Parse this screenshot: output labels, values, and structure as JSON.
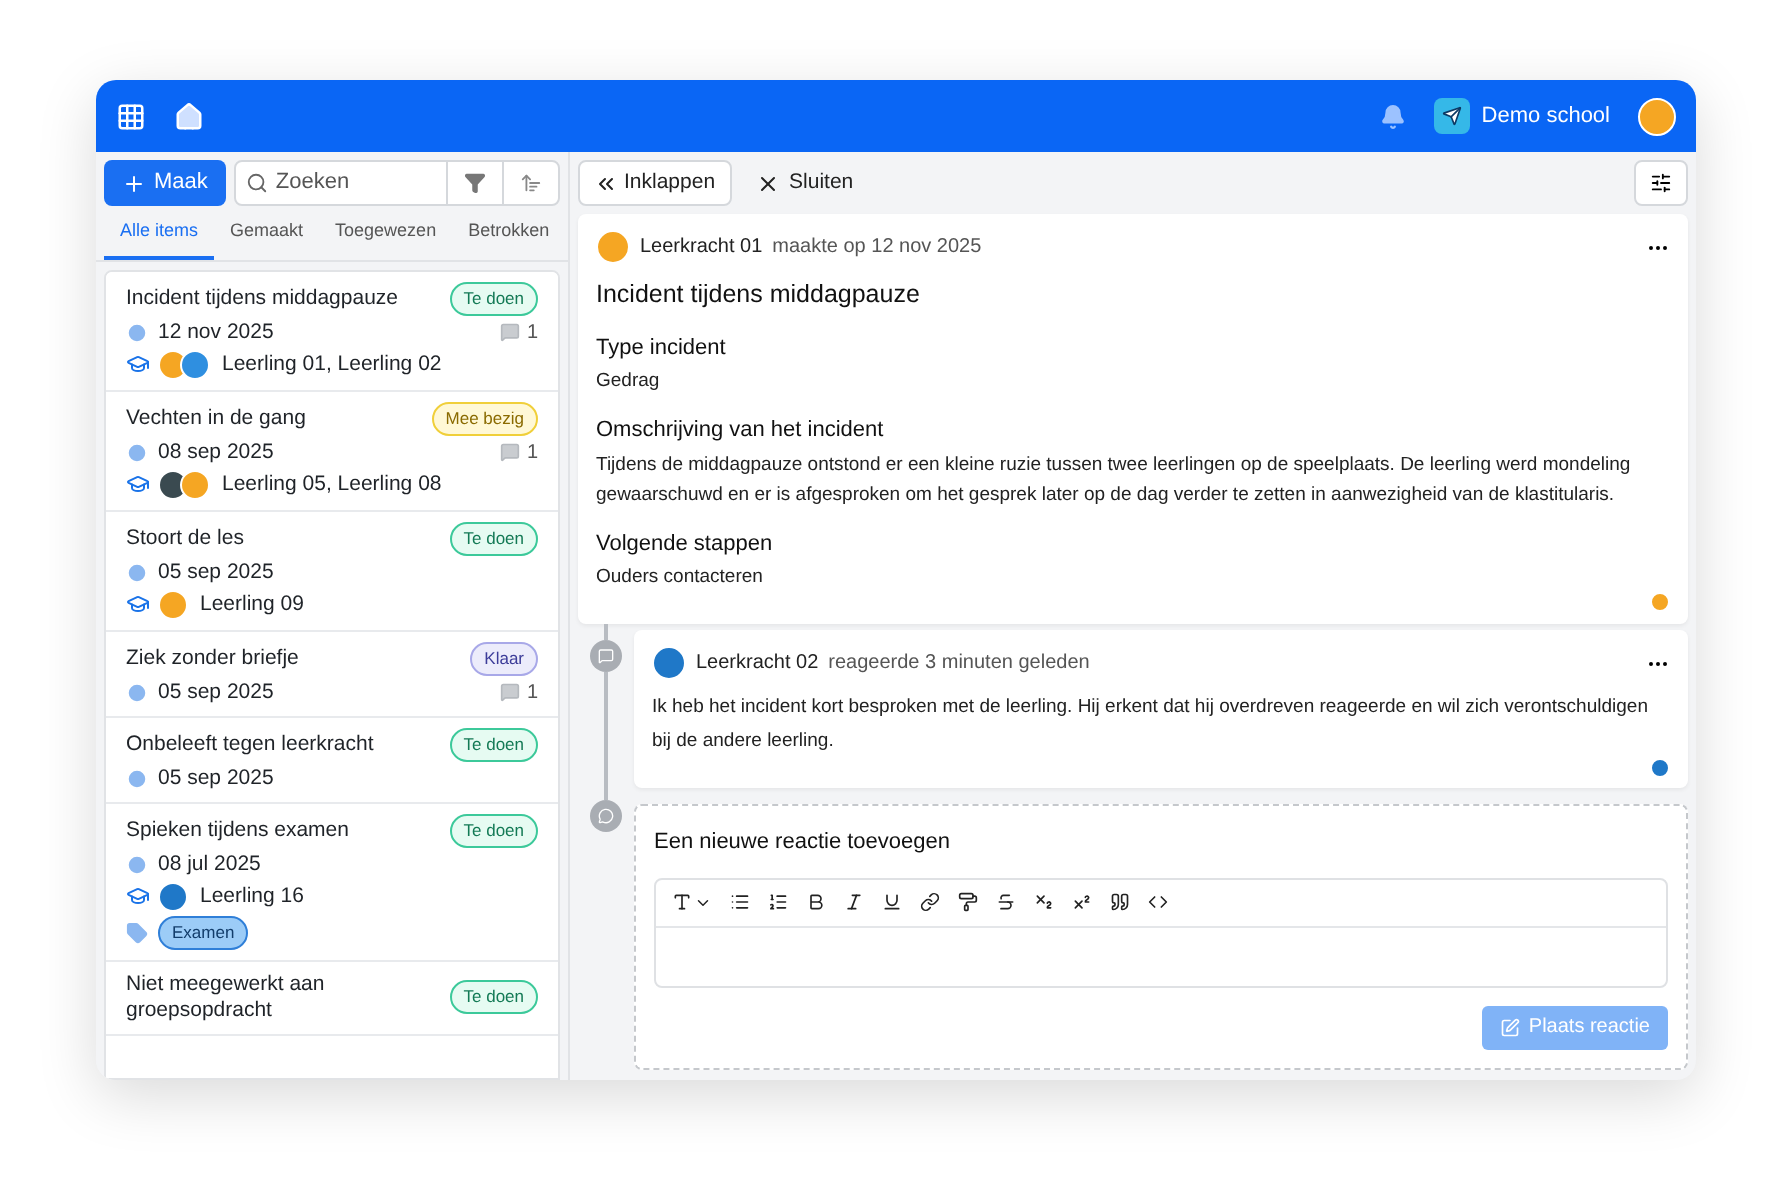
{
  "header": {
    "school": "Demo school"
  },
  "left_toolbar": {
    "create_button": "Maak",
    "search": {
      "placeholder": "Zoeken"
    }
  },
  "tabs": [
    {
      "label": "Alle items",
      "selected": true
    },
    {
      "label": "Gemaakt",
      "selected": false
    },
    {
      "label": "Toegewezen",
      "selected": false
    },
    {
      "label": "Betrokken",
      "selected": false
    }
  ],
  "items": [
    {
      "title": "Incident tijdens middagpauze",
      "status": {
        "label": "Te doen",
        "kind": "todo"
      },
      "date": "12 nov 2025",
      "comments": "1",
      "students": "Leerling 01, Leerling 02",
      "avatars": [
        {
          "color": "#f5a623"
        },
        {
          "color": "#2f8fe0"
        }
      ]
    },
    {
      "title": "Vechten in de gang",
      "status": {
        "label": "Mee bezig",
        "kind": "busy"
      },
      "date": "08 sep 2025",
      "comments": "1",
      "students": "Leerling 05, Leerling 08",
      "avatars": [
        {
          "color": "#3a4a50"
        },
        {
          "color": "#f5a623"
        }
      ]
    },
    {
      "title": "Stoort de les",
      "status": {
        "label": "Te doen",
        "kind": "todo"
      },
      "date": "05 sep 2025",
      "students": "Leerling 09",
      "avatars": [
        {
          "color": "#f5a623"
        }
      ]
    },
    {
      "title": "Ziek zonder briefje",
      "status": {
        "label": "Klaar",
        "kind": "done"
      },
      "date": "05 sep 2025",
      "comments": "1"
    },
    {
      "title": "Onbeleeft tegen leerkracht",
      "status": {
        "label": "Te doen",
        "kind": "todo"
      },
      "date": "05 sep 2025"
    },
    {
      "title": "Spieken tijdens examen",
      "status": {
        "label": "Te doen",
        "kind": "todo"
      },
      "date": "08 jul 2025",
      "students": "Leerling 16",
      "avatars": [
        {
          "color": "#1f78c8"
        }
      ],
      "tags": [
        "Examen"
      ]
    },
    {
      "title": "Niet meegewerkt aan groepsopdracht",
      "status": {
        "label": "Te doen",
        "kind": "todo"
      }
    }
  ],
  "detail_toolbar": {
    "collapse_button": "Inklappen",
    "close_button": "Sluiten"
  },
  "incident": {
    "author": "Leerkracht 01",
    "meta": "maakte op 12 nov 2025",
    "title": "Incident tijdens middagpauze",
    "fields": [
      {
        "label": "Type incident",
        "value": "Gedrag"
      },
      {
        "label": "Omschrijving van het incident",
        "value": "Tijdens de middagpauze ontstond er een kleine ruzie tussen twee leerlingen op de speelplaats. De leerling werd mondeling gewaarschuwd en er is afgesproken om het gesprek later op de dag verder te zetten in aanwezigheid van de klastitularis."
      },
      {
        "label": "Volgende stappen",
        "value": "Ouders contacteren"
      }
    ]
  },
  "comment": {
    "author": "Leerkracht 02",
    "meta": "reageerde 3 minuten geleden",
    "text": "Ik heb het incident kort besproken met de leerling. Hij erkent dat hij overdreven reageerde en wil zich verontschuldigen bij de andere leerling."
  },
  "new_reply": {
    "heading": "Een nieuwe reactie toevoegen",
    "submit_button": "Plaats reactie",
    "submit_disabled": true
  }
}
